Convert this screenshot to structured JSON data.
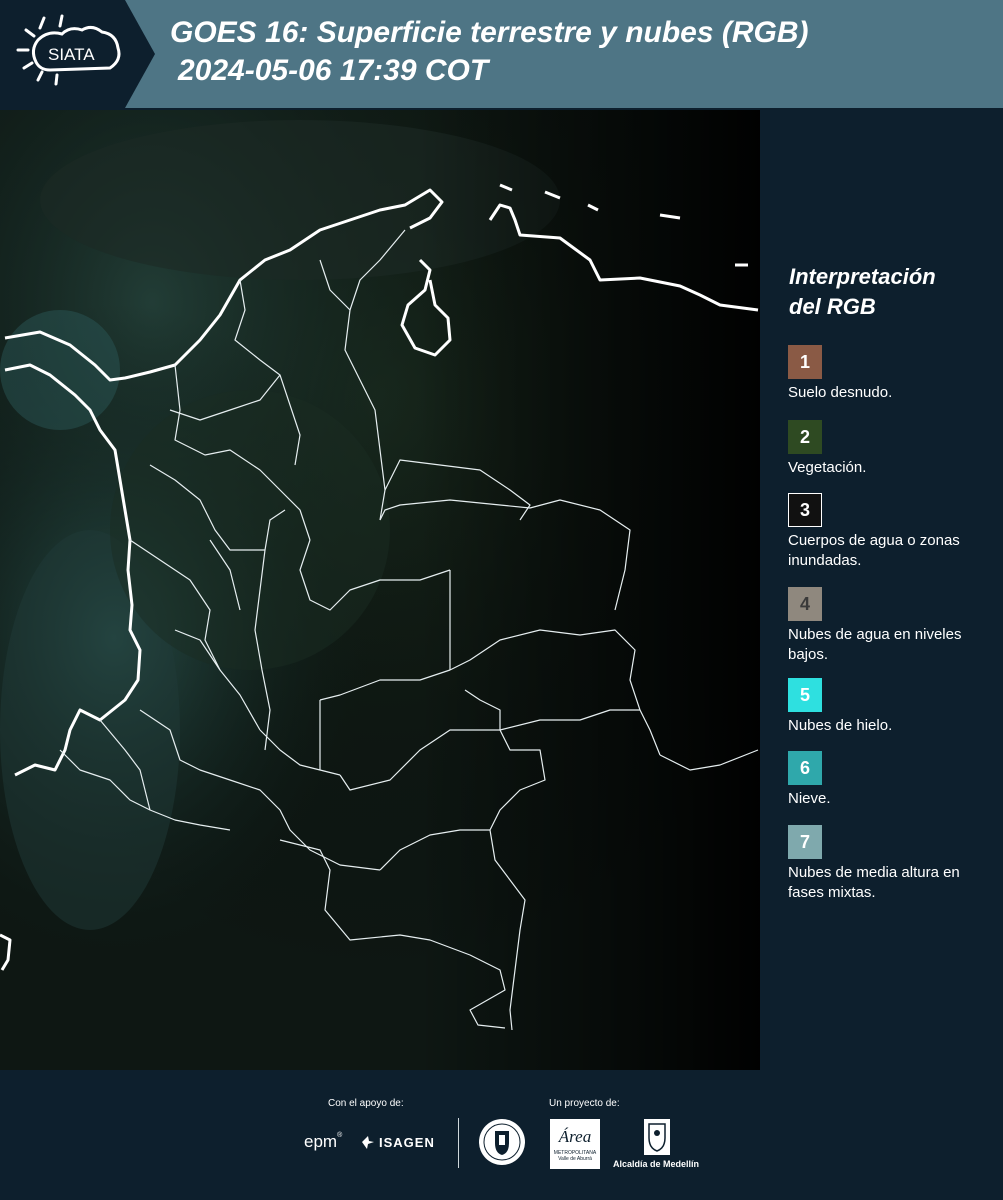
{
  "header": {
    "brand": "SIATA",
    "title_line1": "GOES 16: Superficie terrestre y nubes (RGB)",
    "title_line2": "2024-05-06 17:39 COT"
  },
  "legend": {
    "title_line1": "Interpretación",
    "title_line2": "del RGB",
    "items": [
      {
        "number": "1",
        "label": "Suelo desnudo.",
        "color": "#8a5a45"
      },
      {
        "number": "2",
        "label": "Vegetación.",
        "color": "#2e4a22"
      },
      {
        "number": "3",
        "label": "Cuerpos de agua o zonas inundadas.",
        "color": "#111111"
      },
      {
        "number": "4",
        "label": "Nubes de agua en niveles bajos.",
        "color": "#8f887e"
      },
      {
        "number": "5",
        "label": "Nubes de hielo.",
        "color": "#2ee0e0"
      },
      {
        "number": "6",
        "label": "Nieve.",
        "color": "#2fa8ab"
      },
      {
        "number": "7",
        "label": "Nubes de media altura en fases mixtas.",
        "color": "#7fa9ad"
      }
    ]
  },
  "footer": {
    "support_label": "Con el apoyo de:",
    "project_label": "Un proyecto de:",
    "sponsors": [
      "epm",
      "ISAGEN"
    ],
    "partners": [
      "Área Metropolitana Valle de Aburrá",
      "Alcaldía de Medellín"
    ],
    "epm_text": "epm",
    "isagen_text": "ISAGEN",
    "area_text": "Área",
    "area_sub1": "METROPOLITANA",
    "area_sub2": "Valle de Aburrá",
    "alcaldia_text": "Alcaldía de Medellín"
  }
}
